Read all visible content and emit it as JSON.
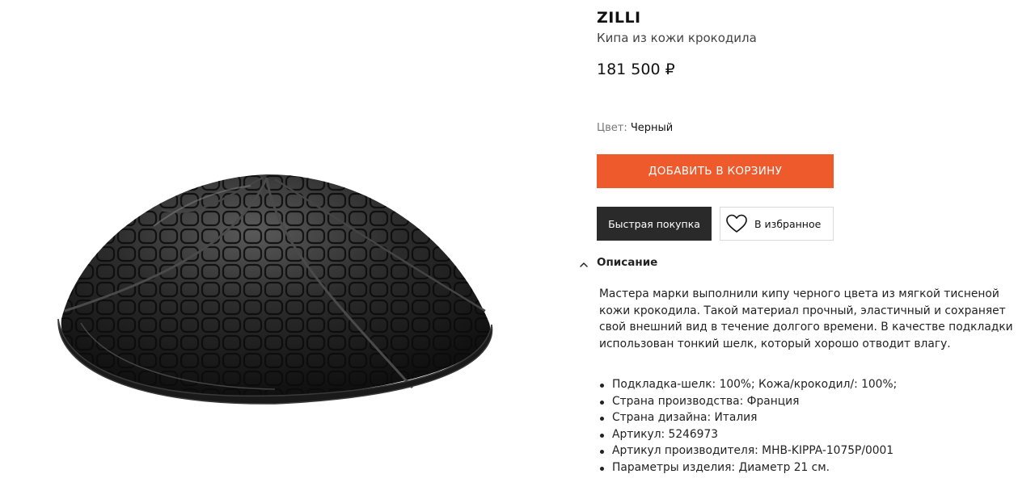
{
  "product": {
    "brand": "ZILLI",
    "name": "Кипа из кожи крокодила",
    "price": "181 500 ₽",
    "image_icon": "product-image",
    "color": {
      "label": "Цвет:",
      "value": "Черный"
    }
  },
  "actions": {
    "add_to_cart": "ДОБАВИТЬ В КОРЗИНУ",
    "quick_buy": "Быстрая покупка",
    "favorite": "В избранное",
    "favorite_icon": "heart-icon"
  },
  "description": {
    "title": "Описание",
    "toggle_icon": "chevron-up-icon",
    "text": "Мастера марки выполнили кипу черного цвета из мягкой тисненой кожи крокодила. Такой  материал прочный, эластичный и сохраняет свой внешний вид в течение долгого времени. В качестве подкладки использован тонкий шелк, который хорошо отводит влагу.",
    "specs": [
      "Подкладка-шелк: 100%; Кожа/крокодил/: 100%;",
      "Страна производства: Франция",
      "Страна дизайна: Италия",
      "Артикул: 5246973",
      "Артикул производителя: MHB-KIPPA-1075P/0001",
      "Параметры изделия: Диаметр 21 см."
    ]
  },
  "colors": {
    "accent": "#ee5a2b",
    "dark_button": "#2a2a2a",
    "border": "#d9d9d9"
  }
}
